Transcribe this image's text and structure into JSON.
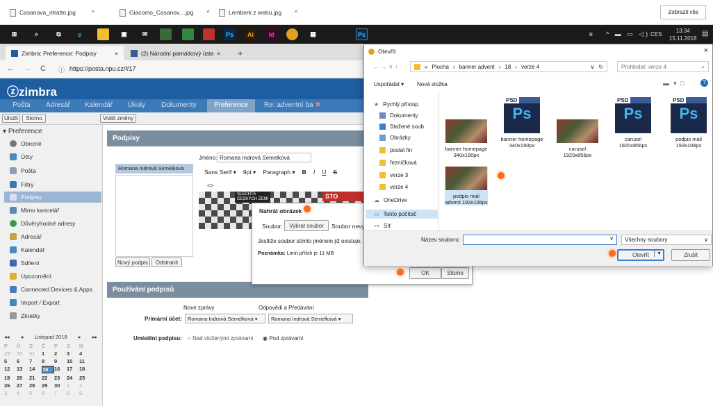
{
  "downloads": {
    "items": [
      "Casanova_ritratto.jpg",
      "Giacomo_Casanov....jpg",
      "Lemberk z webu.jpg"
    ],
    "show_all": "Zobrazit vše"
  },
  "taskbar": {
    "time": "13:34",
    "date": "15.11.2018",
    "lang": "CES"
  },
  "browser": {
    "tabs": [
      "Zimbra: Preference: Podpisy",
      "(2) Národní památkový ústav - H"
    ],
    "url": "https://posta.npu.cz/#17"
  },
  "zimbra": {
    "logo": "zimbra",
    "nav": [
      "Pošta",
      "Adresář",
      "Kalendář",
      "Úkoly",
      "Dokumenty",
      "Preference",
      "Re: adventní ba"
    ],
    "toolbar": {
      "save": "Uložit",
      "cancel": "Storno",
      "revert": "Vrátit změny"
    },
    "sidebar": {
      "title": "Preference",
      "items": [
        "Obecné",
        "Účty",
        "Pošta",
        "Filtry",
        "Podpisy",
        "Mimo kancelář",
        "Důvěryhodné adresy",
        "Adresář",
        "Kalendář",
        "Sdílení",
        "Upozornění",
        "Connected Devices & Apps",
        "Import / Export",
        "Zkratky"
      ]
    },
    "calendar": {
      "month": "Listopad 2018",
      "days": [
        "P",
        "Ú",
        "S",
        "Č",
        "P",
        "S",
        "N"
      ],
      "weeks": [
        [
          "29",
          "30",
          "31",
          "1",
          "2",
          "3",
          "4"
        ],
        [
          "5",
          "6",
          "7",
          "8",
          "9",
          "10",
          "11"
        ],
        [
          "12",
          "13",
          "14",
          "15",
          "16",
          "17",
          "18"
        ],
        [
          "19",
          "20",
          "21",
          "22",
          "23",
          "24",
          "25"
        ],
        [
          "26",
          "27",
          "28",
          "29",
          "30",
          "1",
          "2"
        ],
        [
          "3",
          "4",
          "5",
          "6",
          "7",
          "8",
          "9"
        ]
      ]
    },
    "signatures": {
      "header": "Podpisy",
      "list_item": "Romana Indrová Semelková",
      "name_label": "Jméno:",
      "name_value": "Romana Indrová Semelková",
      "font": "Sans Serif",
      "size": "9pt",
      "format": "Paragraph",
      "new_btn": "Nový podpis",
      "delete_btn": "Odstranit",
      "banner1": "SLECHTA",
      "banner2": "ČESKÝCH ZEMÍ",
      "banner3": "STO"
    },
    "usage": {
      "header": "Používání podpisů",
      "col1": "Nové zprávy",
      "col2": "Odpovědi a Předávání",
      "primary_label": "Primární účet:",
      "primary1": "Romana Indrová Semelková",
      "primary2": "Romana Indrová Semelková",
      "placement_label": "Umístění podpisu:",
      "radio1": "Nad vloženými zprávami",
      "radio2": "Pod zprávami"
    }
  },
  "upload_dialog": {
    "title": "Nahrát obrázek",
    "file_label": "Soubor:",
    "choose": "Vybrat soubor",
    "nofile": "Soubor nevybr",
    "exists": "Jestliže soubor stímto jménem již existuje:",
    "note_label": "Poznámka:",
    "note": "Limit příloh je 11 MB",
    "ok": "OK",
    "cancel": "Storno"
  },
  "open_dialog": {
    "title": "Otevřít",
    "path": [
      "Plocha",
      "banner advent",
      "18",
      "verze 4"
    ],
    "search": "Prohledat: verze 4",
    "organize": "Uspořádat ▾",
    "new_folder": "Nová složka",
    "nav": [
      "Rychlý přístup",
      "Dokumenty",
      "Stažené soub",
      "Obrázky",
      "poslat fin",
      "řezníčková",
      "verze 3",
      "verze 4",
      "OneDrive",
      "Tento počítač",
      "Síť"
    ],
    "files": [
      {
        "name": "banner homepage 340x190px",
        "kind": "thumb"
      },
      {
        "name": "banner homepage 340x190px",
        "kind": "psd"
      },
      {
        "name": "carusel 1920x856px",
        "kind": "thumb"
      },
      {
        "name": "carusel 1920x856px",
        "kind": "psd"
      },
      {
        "name": "podpis mail 193x108px",
        "kind": "psd"
      },
      {
        "name": "podpis mail advent 193x108px",
        "kind": "thumb"
      }
    ],
    "filename_label": "Název souboru:",
    "filetype": "Všechny soubory",
    "open": "Otevřít",
    "cancel": "Zrušit"
  }
}
